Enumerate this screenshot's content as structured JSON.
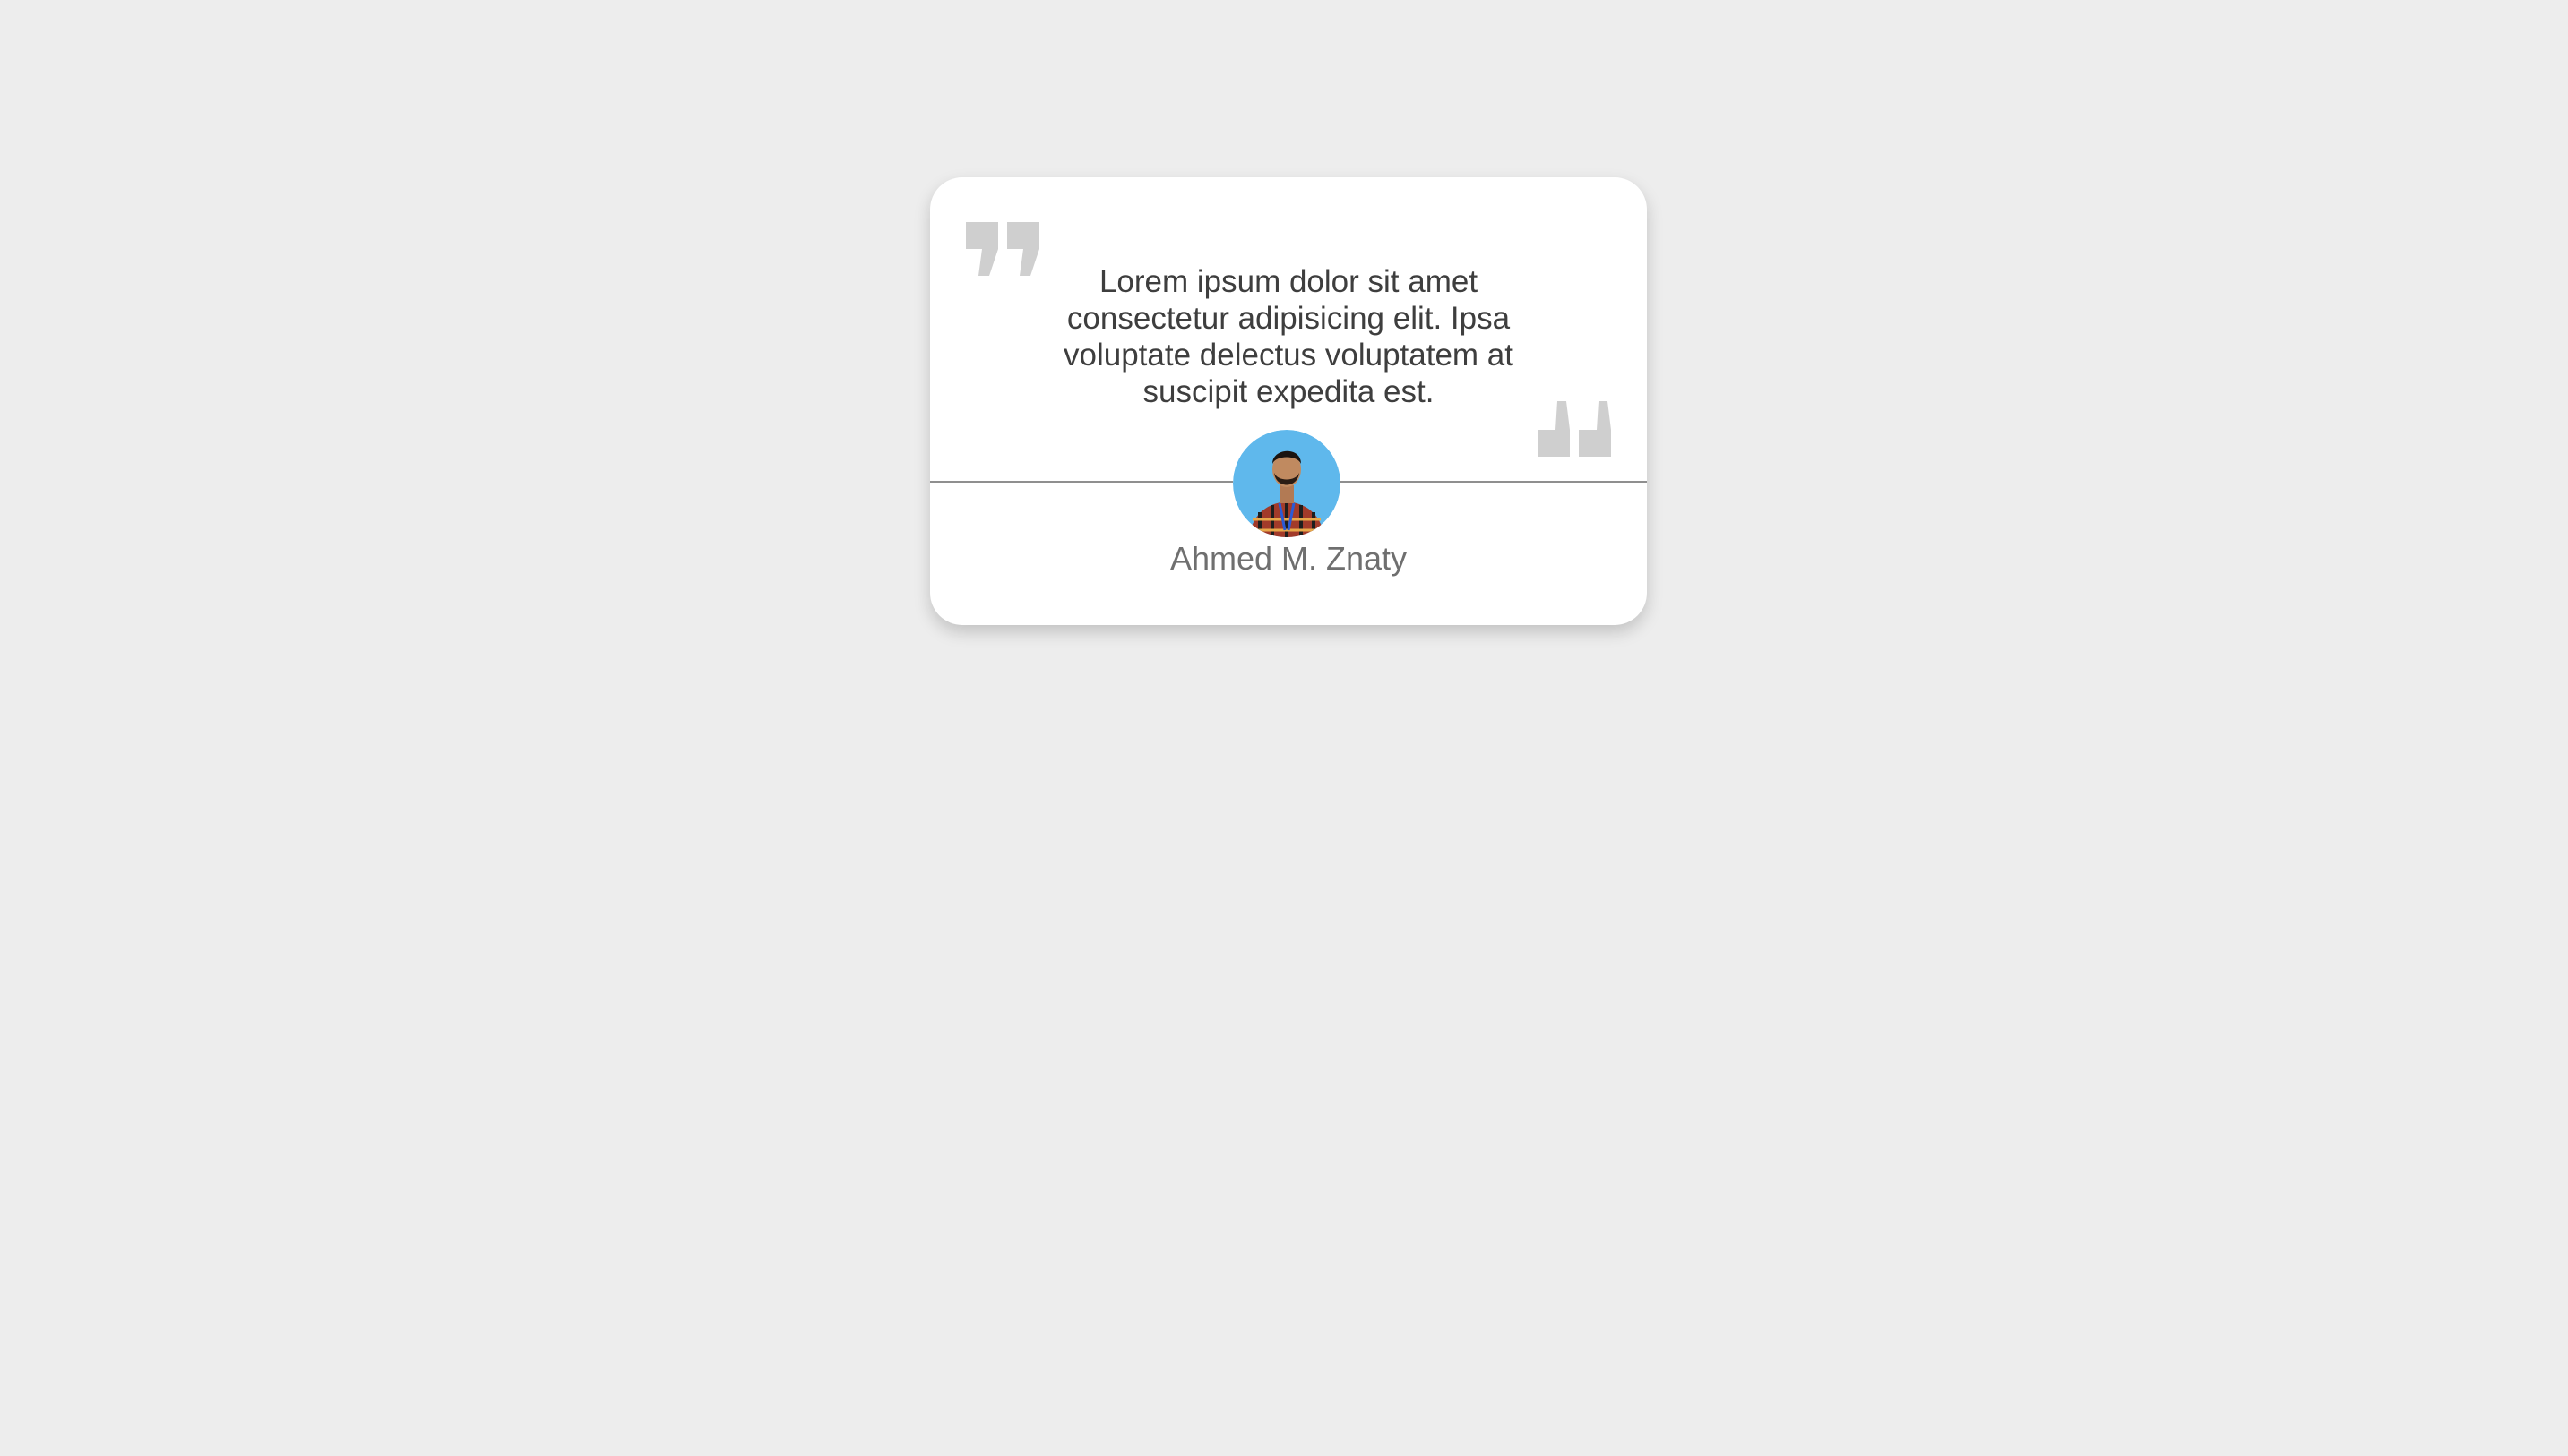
{
  "testimonial": {
    "quote": "Lorem ipsum dolor sit amet consectetur adipisicing elit. Ipsa voluptate delectus voluptatem at suscipit expedita est.",
    "author_name": "Ahmed M. Znaty",
    "open_quote_icon": "quote-open-icon",
    "close_quote_icon": "quote-close-icon",
    "avatar_icon": "avatar-photo"
  },
  "colors": {
    "page_background": "#ededed",
    "card_background": "#ffffff",
    "quote_icon": "#cfcfcf",
    "quote_text": "#3e3e3e",
    "author_name": "#6f6f6f",
    "divider": "#8f8f8f",
    "avatar_background": "#5fb8ec"
  }
}
